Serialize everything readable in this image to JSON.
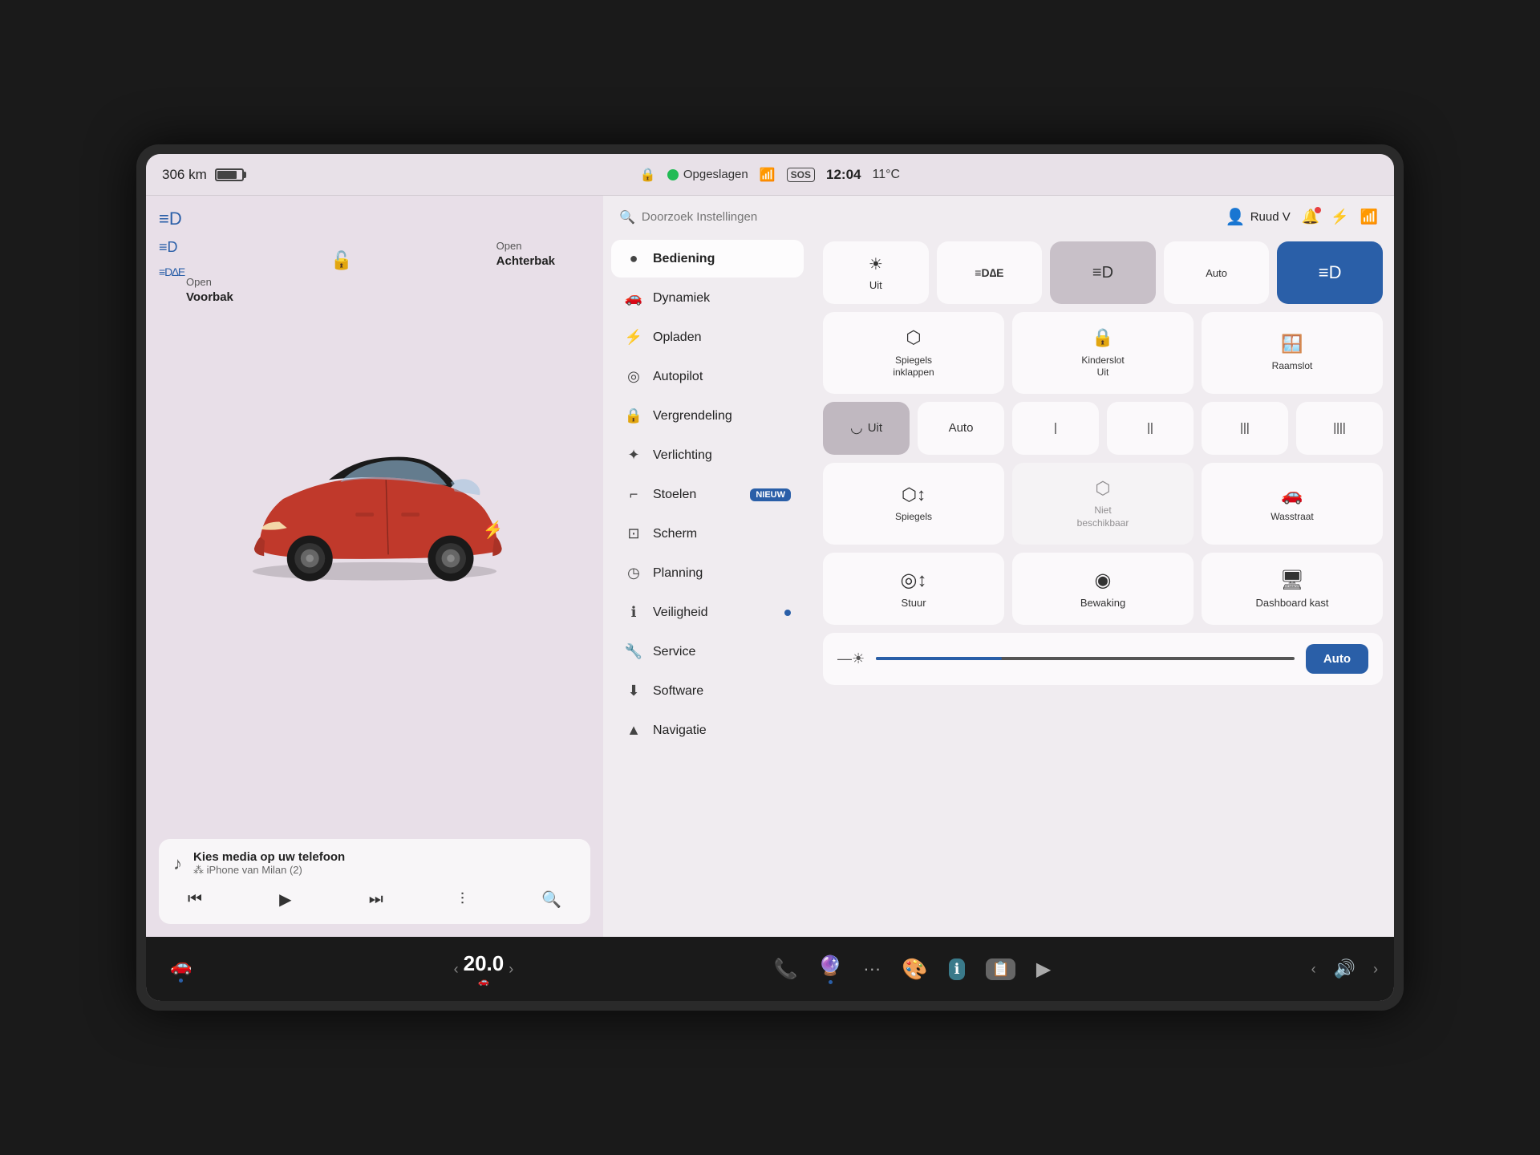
{
  "statusBar": {
    "range": "306 km",
    "saved": "Opgeslagen",
    "time": "12:04",
    "temp": "11°C",
    "sos": "SOS"
  },
  "leftPanel": {
    "openVoorbak": "Open\nVoorbak",
    "openVoorbakLine1": "Open",
    "openVoorbakLine2": "Voorbak",
    "openAchterbakLine1": "Open",
    "openAchterbakLine2": "Achterbak"
  },
  "mediaPlayer": {
    "title": "Kies media op uw telefoon",
    "source": "⁂ iPhone van Milan (2)"
  },
  "search": {
    "placeholder": "Doorzoek Instellingen"
  },
  "user": {
    "name": "Ruud V"
  },
  "navMenu": {
    "items": [
      {
        "id": "bediening",
        "icon": "●",
        "label": "Bediening",
        "active": true
      },
      {
        "id": "dynamiek",
        "icon": "🚗",
        "label": "Dynamiek",
        "active": false
      },
      {
        "id": "opladen",
        "icon": "⚡",
        "label": "Opladen",
        "active": false
      },
      {
        "id": "autopilot",
        "icon": "◎",
        "label": "Autopilot",
        "active": false
      },
      {
        "id": "vergrendeling",
        "icon": "🔒",
        "label": "Vergrendeling",
        "active": false
      },
      {
        "id": "verlichting",
        "icon": "✦",
        "label": "Verlichting",
        "active": false
      },
      {
        "id": "stoelen",
        "icon": "⌐",
        "label": "Stoelen",
        "badge": "NIEUW",
        "active": false
      },
      {
        "id": "scherm",
        "icon": "⊡",
        "label": "Scherm",
        "active": false
      },
      {
        "id": "planning",
        "icon": "◷",
        "label": "Planning",
        "active": false
      },
      {
        "id": "veiligheid",
        "icon": "ℹ",
        "label": "Veiligheid",
        "dot": true,
        "active": false
      },
      {
        "id": "service",
        "icon": "🔧",
        "label": "Service",
        "active": false
      },
      {
        "id": "software",
        "icon": "⬇",
        "label": "Software",
        "active": false
      },
      {
        "id": "navigatie",
        "icon": "▲",
        "label": "Navigatie",
        "active": false
      }
    ]
  },
  "controls": {
    "lightsRow": [
      {
        "id": "uit",
        "label": "Uit",
        "icon": "☀",
        "active": false
      },
      {
        "id": "edge",
        "label": "EDGE",
        "icon": "≡",
        "active": false
      },
      {
        "id": "lights-d",
        "label": "D",
        "icon": "≡D",
        "active": false
      },
      {
        "id": "auto-lights",
        "label": "Auto",
        "active": false
      },
      {
        "id": "lights-active",
        "label": "",
        "icon": "≡D",
        "active": true
      }
    ],
    "mirrorsRow": [
      {
        "id": "spiegels-inklappen",
        "label": "Spiegels\ninklappen",
        "icon": "⬡"
      },
      {
        "id": "kinderslot",
        "label": "Kinderslot\nUit",
        "icon": "🔒"
      },
      {
        "id": "raamslot",
        "label": "Raamslot",
        "icon": "🚗"
      }
    ],
    "wiperRow": [
      {
        "id": "wiper-uit",
        "label": "Uit",
        "icon": "◡",
        "active": true
      },
      {
        "id": "wiper-auto",
        "label": "Auto",
        "active": false
      },
      {
        "id": "wiper-1",
        "label": "|",
        "active": false
      },
      {
        "id": "wiper-2",
        "label": "||",
        "active": false
      },
      {
        "id": "wiper-3",
        "label": "|||",
        "active": false
      },
      {
        "id": "wiper-4",
        "label": "||||",
        "active": false
      }
    ],
    "miscRow": [
      {
        "id": "spiegels",
        "label": "Spiegels",
        "icon": "⬡↕"
      },
      {
        "id": "niet-beschikbaar",
        "label": "Niet\nbeschikbaar",
        "icon": "⬡",
        "disabled": true
      },
      {
        "id": "wasstraat",
        "label": "Wasstraat",
        "icon": "🚗"
      }
    ],
    "bottomRow": [
      {
        "id": "stuur",
        "label": "Stuur",
        "icon": "◎↕"
      },
      {
        "id": "bewaking",
        "label": "Bewaking",
        "icon": "◉"
      },
      {
        "id": "dashboard-kast",
        "label": "Dashboard kast",
        "icon": "🖥"
      }
    ],
    "brightnessAuto": "Auto"
  },
  "taskbar": {
    "speedValue": "20.0",
    "speedUnit": "",
    "apps": [
      {
        "id": "phone",
        "icon": "📞",
        "color": "#22bb55"
      },
      {
        "id": "camera",
        "icon": "🔮",
        "dot": true
      },
      {
        "id": "apps",
        "icon": "···"
      },
      {
        "id": "color",
        "icon": "🎨"
      },
      {
        "id": "info",
        "icon": "ℹ",
        "bg": "#3a7a8a"
      },
      {
        "id": "cards",
        "icon": "📋",
        "bg": "#888"
      },
      {
        "id": "play",
        "icon": "▶"
      }
    ],
    "volumeLabel": "🔊",
    "carIcon": "🚗"
  }
}
